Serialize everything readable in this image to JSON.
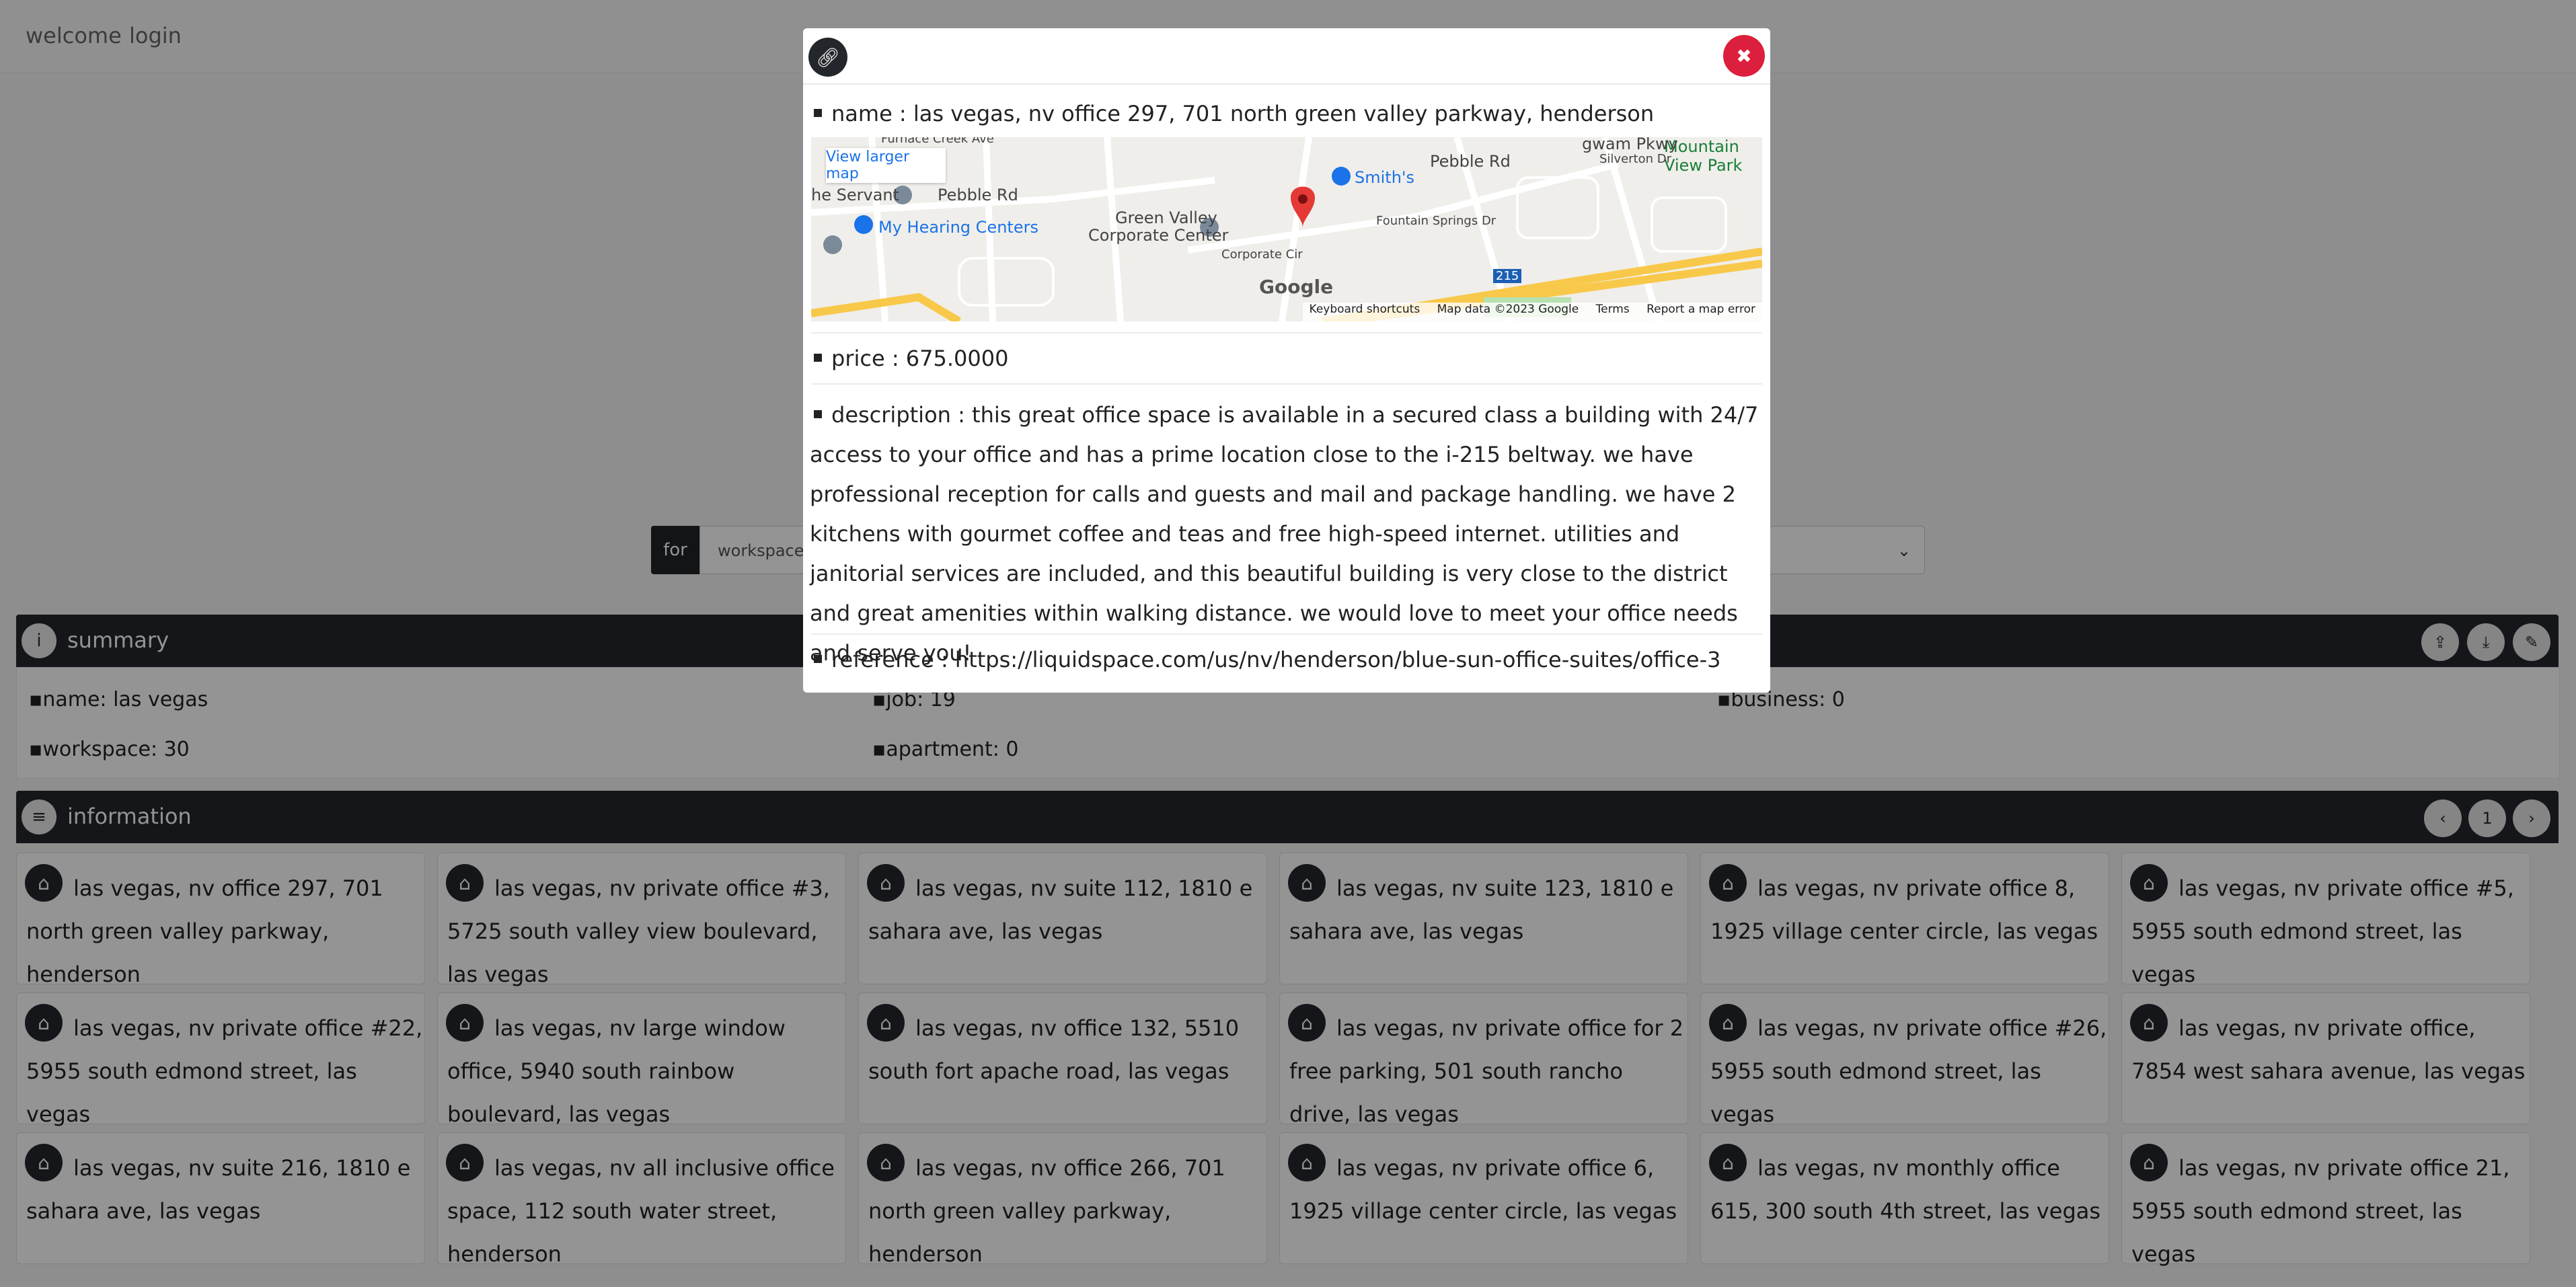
{
  "nav": {
    "welcome": "welcome",
    "login": "login"
  },
  "search": {
    "for_label": "for",
    "type_value": "workspaces"
  },
  "summary": {
    "title": "summary",
    "items": {
      "name": "name: las vegas",
      "job": "job: 19",
      "business": "business: 0",
      "workspace": "workspace: 30",
      "apartment": "apartment: 0"
    }
  },
  "information": {
    "title": "information",
    "page": "1",
    "cards": [
      "las vegas, nv office 297, 701 north green valley parkway, henderson",
      "las vegas, nv private office #3, 5725 south valley view boulevard, las vegas",
      "las vegas, nv suite 112, 1810 e sahara ave, las vegas",
      "las vegas, nv suite 123, 1810 e sahara ave, las vegas",
      "las vegas, nv private office 8, 1925 village center circle, las vegas",
      "las vegas, nv private office #5, 5955 south edmond street, las vegas",
      "las vegas, nv private office #22, 5955 south edmond street, las vegas",
      "las vegas, nv large window office, 5940 south rainbow boulevard, las vegas",
      "las vegas, nv office 132, 5510 south fort apache road, las vegas",
      "las vegas, nv private office for 2 free parking, 501 south rancho drive, las vegas",
      "las vegas, nv private office #26, 5955 south edmond street, las vegas",
      "las vegas, nv private office, 7854 west sahara avenue, las vegas",
      "las vegas, nv suite 216, 1810 e sahara ave, las vegas",
      "las vegas, nv all inclusive office space, 112 south water street, henderson",
      "las vegas, nv office 266, 701 north green valley parkway, henderson",
      "las vegas, nv private office 6, 1925 village center circle, las vegas",
      "las vegas, nv monthly office 615, 300 south 4th street, las vegas",
      "las vegas, nv private office 21, 5955 south edmond street, las vegas"
    ]
  },
  "modal": {
    "name": "name : las vegas, nv office 297, 701 north green valley parkway, henderson",
    "price": "price : 675.0000",
    "description": "description : this great office space is available in a secured class a building with 24/7 access to your office and has a prime location close to the i-215 beltway. we have professional reception for calls and guests and mail and package handling. we have 2 kitchens with gourmet coffee and teas and free high-speed internet. utilities and janitorial services are included, and this beautiful building is very close to the district and great amenities within walking distance. we would love to meet your office needs and serve you!",
    "reference": "reference : https://liquidspace.com/us/nv/henderson/blue-sun-office-suites/office-3",
    "close_symbol": "✖",
    "map": {
      "view_larger": "View larger map",
      "labels": {
        "furnace": "Furnace Creek Ave",
        "pebble1": "Pebble Rd",
        "pebble2": "Pebble Rd",
        "servant": "he Servant",
        "hearing": "My Hearing Centers",
        "gv": "Green Valley",
        "gv2": "Corporate Center",
        "corp_cir": "Corporate Cir",
        "smiths": "Smith's",
        "mountain": "Mountain",
        "mountain2": "View Park",
        "silverton": "Silverton Dr",
        "wigwam": "gwam Pkwy",
        "fountain": "Fountain Springs Dr",
        "highway": "215"
      },
      "google": "Google",
      "footer": [
        "Keyboard shortcuts",
        "Map data ©2023 Google",
        "Terms",
        "Report a map error"
      ]
    }
  },
  "colors": {
    "dark": "#23272b",
    "close": "#dc1f3c",
    "link_blue": "#1a73e8",
    "pin_red": "#e53935"
  }
}
